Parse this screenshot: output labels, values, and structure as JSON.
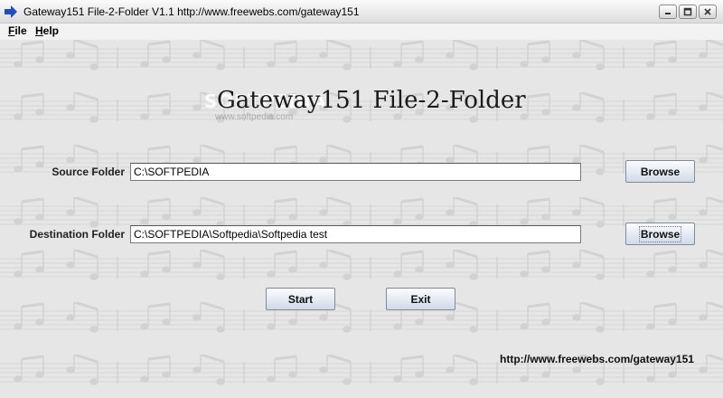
{
  "window": {
    "title": "Gateway151 File-2-Folder V1.1   http://www.freewebs.com/gateway151"
  },
  "menu": {
    "items": [
      {
        "label": "File"
      },
      {
        "label": "Help"
      }
    ]
  },
  "watermark": {
    "text": "SOFTPEDIA",
    "url": "www.softpedia.com"
  },
  "app": {
    "title": "Gateway151 File-2-Folder"
  },
  "source": {
    "label": "Source Folder",
    "value": "C:\\SOFTPEDIA",
    "browse_label": "Browse"
  },
  "destination": {
    "label": "Destination Folder",
    "value": "C:\\SOFTPEDIA\\Softpedia\\Softpedia test",
    "browse_label": "Browse"
  },
  "actions": {
    "start_label": "Start",
    "exit_label": "Exit"
  },
  "footer": {
    "url": "http://www.freewebs.com/gateway151"
  },
  "colors": {
    "accent_arrow": "#1f4fbf",
    "button_border": "#7f8b9a"
  },
  "icons": {
    "app": "arrow-right-icon",
    "minimize": "minimize-icon",
    "maximize": "maximize-icon",
    "close": "close-icon"
  }
}
